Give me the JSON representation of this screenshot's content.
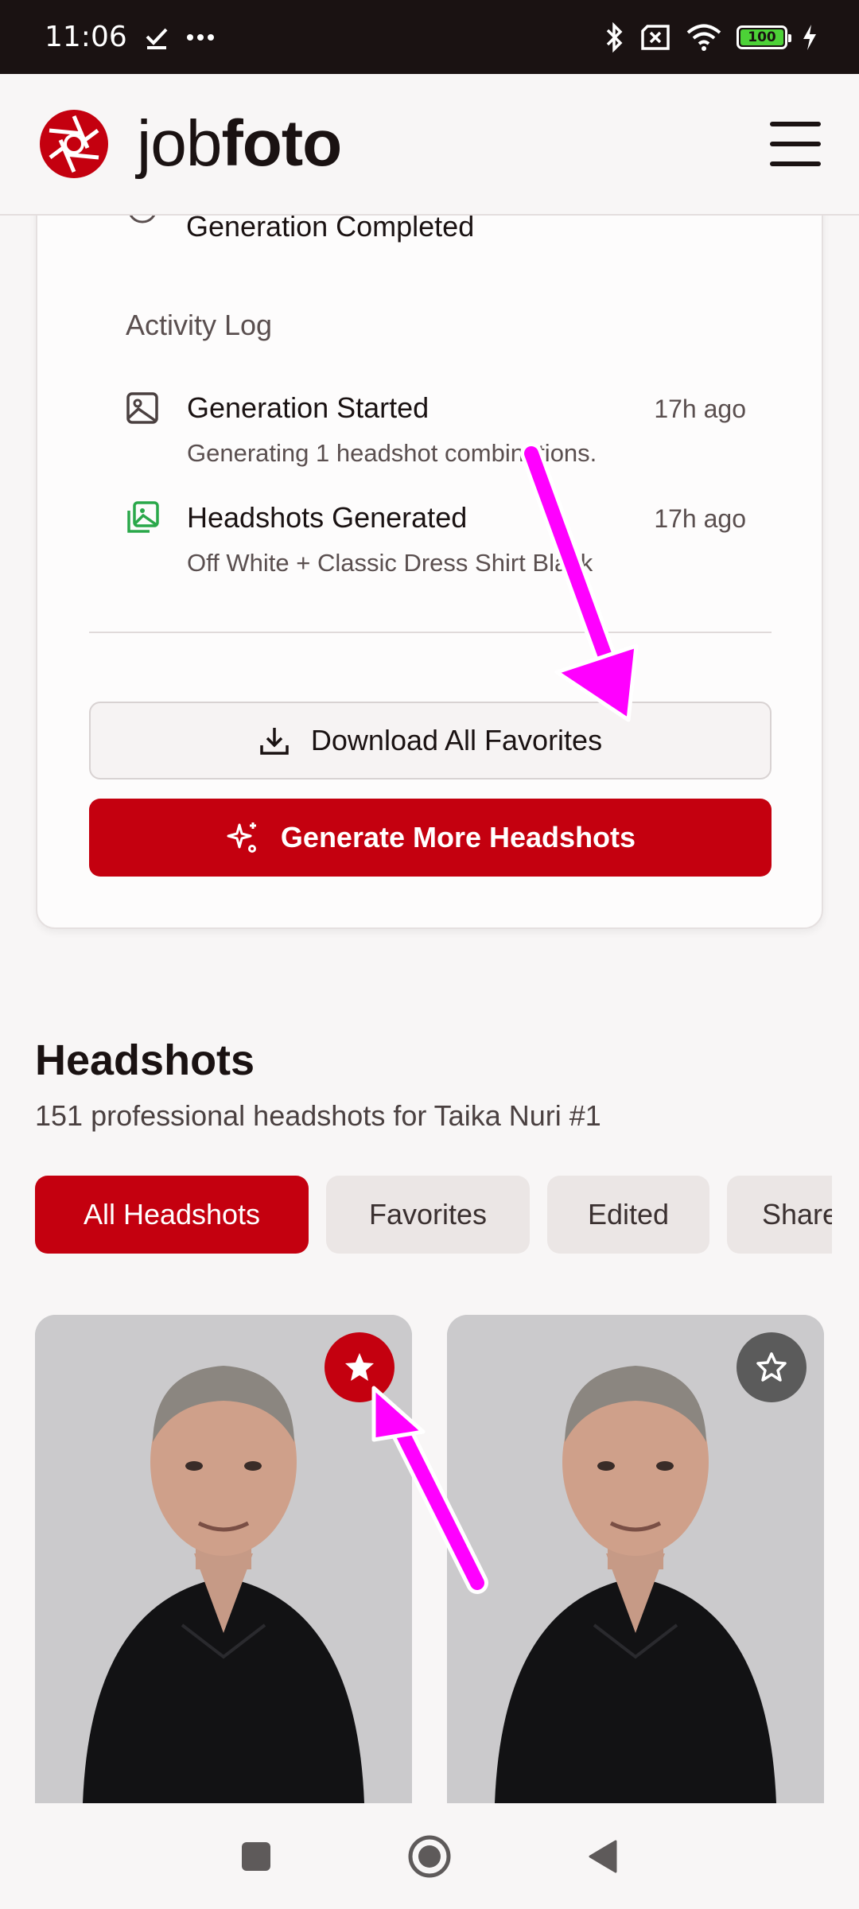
{
  "status_bar": {
    "time": "11:06",
    "notification_icons": [
      "check-icon",
      "more-dots-icon"
    ],
    "system_icons": [
      "bluetooth-icon",
      "sim-off-icon",
      "wifi-icon",
      "battery-icon",
      "charging-icon"
    ],
    "battery_level": "100"
  },
  "header": {
    "brand_prefix": "job",
    "brand_suffix": "foto",
    "logo_color": "#c4000f"
  },
  "card": {
    "completed_label": "Generation Completed",
    "activity_log_title": "Activity Log",
    "log": [
      {
        "icon": "image-icon",
        "title": "Generation Started",
        "time": "17h ago",
        "description": "Generating 1 headshot combinations."
      },
      {
        "icon": "images-icon",
        "title": "Headshots Generated",
        "time": "17h ago",
        "description": "Off White + Classic Dress Shirt Black"
      }
    ],
    "download_button": "Download All Favorites",
    "generate_button": "Generate More Headshots"
  },
  "headshots": {
    "title": "Headshots",
    "subtitle": "151 professional headshots for Taika Nuri #1",
    "tabs": [
      "All Headshots",
      "Favorites",
      "Edited",
      "Shared"
    ],
    "active_tab": "All Headshots",
    "photos": [
      {
        "favorite": true
      },
      {
        "favorite": false
      }
    ]
  },
  "colors": {
    "accent": "#c4000f",
    "annotation_arrow": "#ff00ff"
  }
}
